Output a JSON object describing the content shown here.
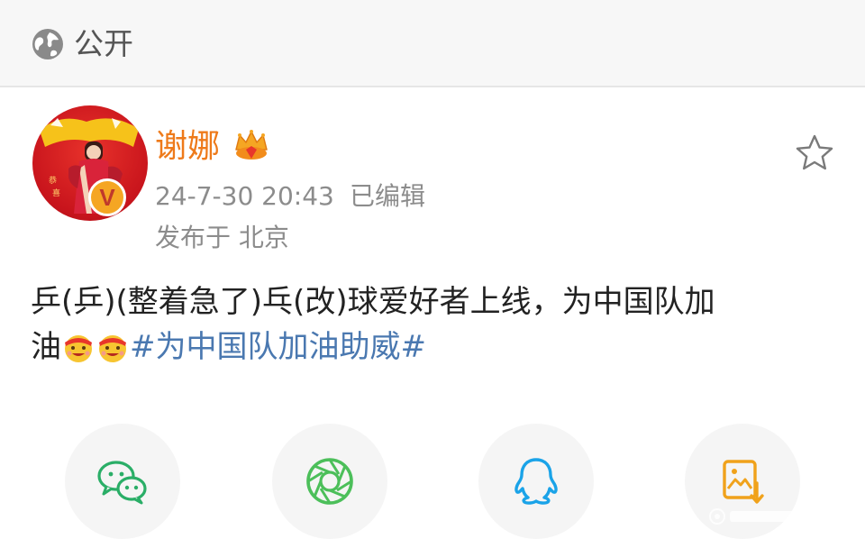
{
  "header": {
    "visibility_icon": "globe-icon",
    "visibility_label": "公开"
  },
  "author": {
    "name": "谢娜",
    "badge_icon": "crown-icon",
    "verified_mark": "V",
    "avatar_icon": "avatar-image"
  },
  "meta": {
    "time": "24-7-30 20:43",
    "edited": "已编辑",
    "location": "发布于 北京"
  },
  "post": {
    "line1": "乒(乒)(整着急了)乓(改)球爱好者上线，为中国队加",
    "line2_text": "油",
    "emojis": [
      "cheer-emoji",
      "cheer-emoji"
    ],
    "hashtag": "#为中国队加油助威#"
  },
  "actions": {
    "favorite_icon": "star-icon",
    "share": [
      {
        "icon": "wechat-icon"
      },
      {
        "icon": "moments-icon"
      },
      {
        "icon": "qq-icon"
      },
      {
        "icon": "save-image-icon"
      }
    ]
  },
  "colors": {
    "username": "#ee7a1a",
    "hashtag": "#4a78b0",
    "meta": "#8c8c8c",
    "wechat": "#2aae67",
    "moments": "#4cbf5a",
    "qq": "#1aa3e8",
    "save": "#f0a21b"
  }
}
